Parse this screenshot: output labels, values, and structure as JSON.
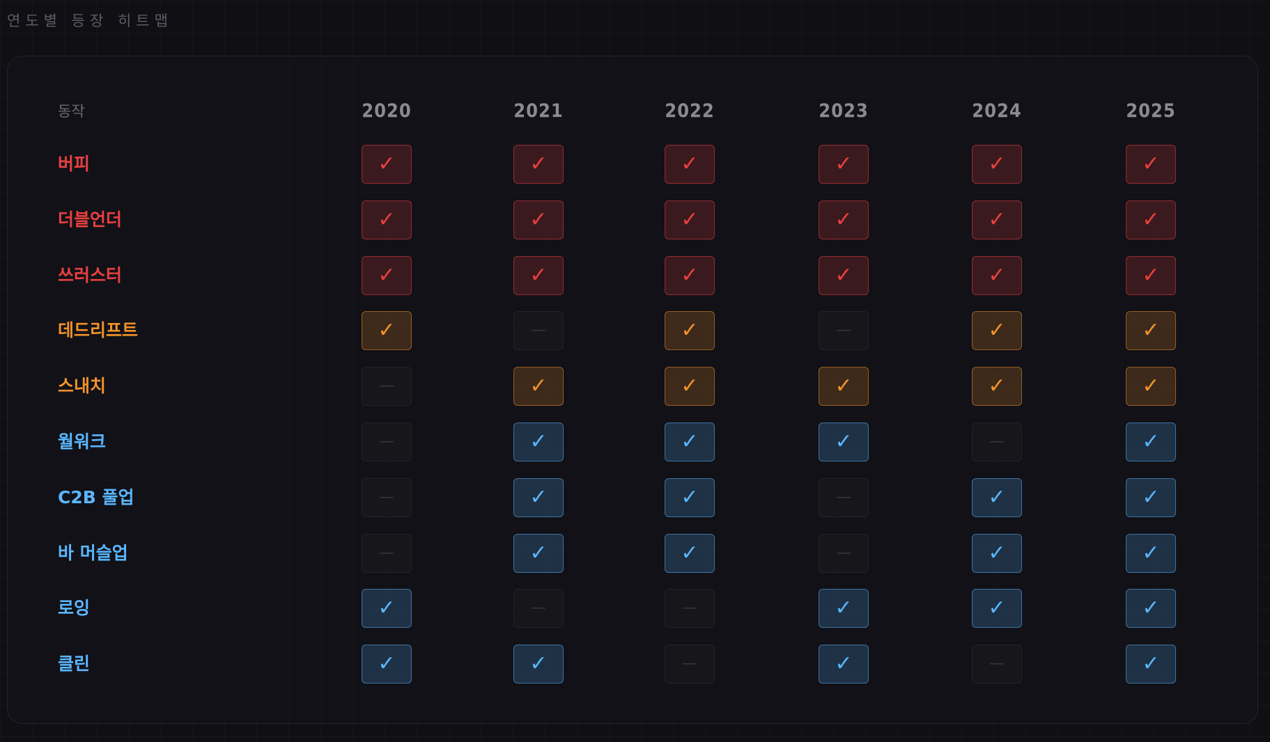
{
  "page_title": "연도별 등장 히트맵",
  "chart_data": {
    "type": "heatmap",
    "title": "연도별 등장 히트맵",
    "row_header": "동작",
    "columns": [
      "2020",
      "2021",
      "2022",
      "2023",
      "2024",
      "2025"
    ],
    "on_symbol": "✓",
    "off_symbol": "—",
    "colors": {
      "red": "#e8403f",
      "orange": "#f0922a",
      "blue": "#5bb6ff"
    },
    "rows": [
      {
        "label": "버피",
        "color": "red",
        "values": [
          1,
          1,
          1,
          1,
          1,
          1
        ]
      },
      {
        "label": "더블언더",
        "color": "red",
        "values": [
          1,
          1,
          1,
          1,
          1,
          1
        ]
      },
      {
        "label": "쓰러스터",
        "color": "red",
        "values": [
          1,
          1,
          1,
          1,
          1,
          1
        ]
      },
      {
        "label": "데드리프트",
        "color": "orange",
        "values": [
          1,
          0,
          1,
          0,
          1,
          1
        ]
      },
      {
        "label": "스내치",
        "color": "orange",
        "values": [
          0,
          1,
          1,
          1,
          1,
          1
        ]
      },
      {
        "label": "월워크",
        "color": "blue",
        "values": [
          0,
          1,
          1,
          1,
          0,
          1
        ]
      },
      {
        "label": "C2B 풀업",
        "color": "blue",
        "values": [
          0,
          1,
          1,
          0,
          1,
          1
        ]
      },
      {
        "label": "바 머슬업",
        "color": "blue",
        "values": [
          0,
          1,
          1,
          0,
          1,
          1
        ]
      },
      {
        "label": "로잉",
        "color": "blue",
        "values": [
          1,
          0,
          0,
          1,
          1,
          1
        ]
      },
      {
        "label": "클린",
        "color": "blue",
        "values": [
          1,
          1,
          0,
          1,
          0,
          1
        ]
      }
    ]
  }
}
